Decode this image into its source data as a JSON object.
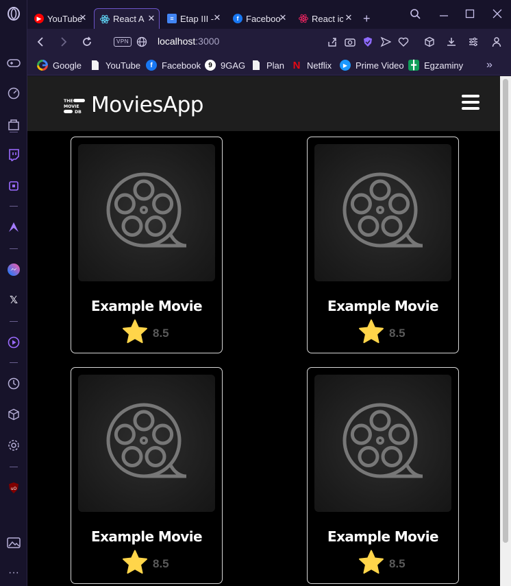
{
  "browser": {
    "tabs": [
      {
        "title": "YouTube",
        "favicon": "youtube-icon",
        "color": "#ff0000"
      },
      {
        "title": "React App",
        "favicon": "react-icon",
        "color": "#61dafb",
        "active": true
      },
      {
        "title": "Etap III -",
        "favicon": "docs-icon",
        "color": "#4285f4"
      },
      {
        "title": "Facebook",
        "favicon": "facebook-icon",
        "color": "#1877f2"
      },
      {
        "title": "React icons",
        "favicon": "react-icon",
        "color": "#e0245e"
      }
    ],
    "new_tab_label": "+",
    "address": {
      "vpn_label": "VPN",
      "host": "localhost",
      "port": ":3000"
    },
    "bookmarks": [
      {
        "label": "Google",
        "icon": "google-icon"
      },
      {
        "label": "YouTube",
        "icon": "page-icon"
      },
      {
        "label": "Facebook",
        "icon": "facebook-icon"
      },
      {
        "label": "9GAG",
        "icon": "9gag-icon"
      },
      {
        "label": "Plan",
        "icon": "page-icon"
      },
      {
        "label": "Netflix",
        "icon": "netflix-icon"
      },
      {
        "label": "Prime Video",
        "icon": "prime-video-icon"
      },
      {
        "label": "Egzaminy",
        "icon": "sheets-icon"
      }
    ],
    "more_bookmarks": "»"
  },
  "app": {
    "logo_lines": [
      "THE",
      "MOVIE",
      "DB"
    ],
    "title": "MoviesApp",
    "accent": "#ffd54a"
  },
  "movies": [
    {
      "title": "Example Movie",
      "rating": "8.5"
    },
    {
      "title": "Example Movie",
      "rating": "8.5"
    },
    {
      "title": "Example Movie",
      "rating": "8.5"
    },
    {
      "title": "Example Movie",
      "rating": "8.5"
    }
  ]
}
